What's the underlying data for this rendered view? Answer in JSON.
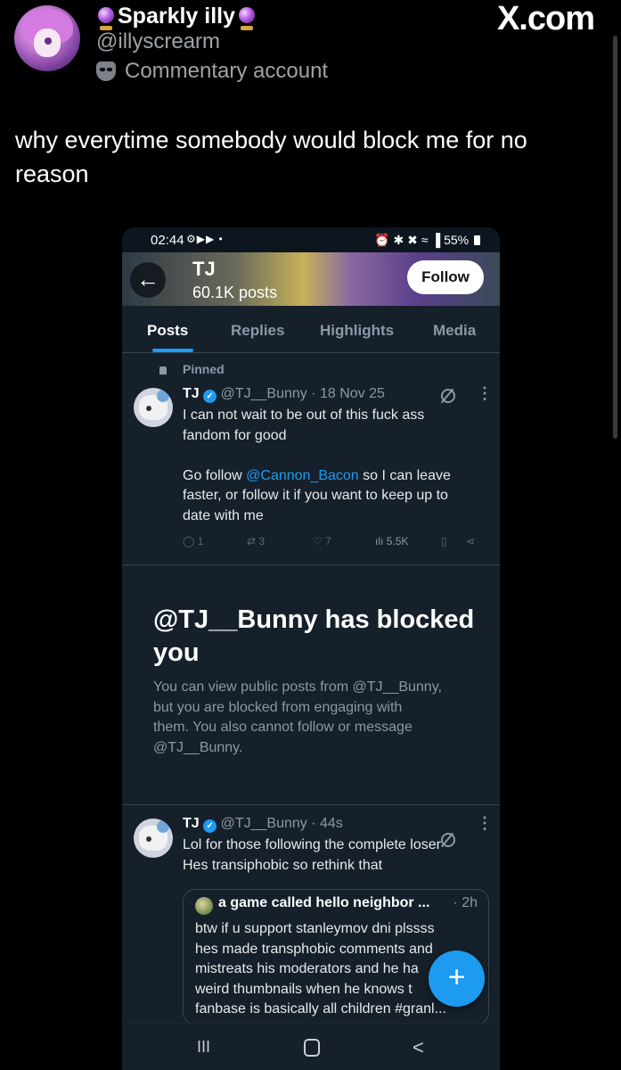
{
  "post": {
    "display_name": "Sparkly illy",
    "handle": "@illyscrearm",
    "account_label": "Commentary account",
    "brand": "X.com",
    "text": "why everytime somebody would block me for no reason"
  },
  "screenshot": {
    "statusbar": {
      "time": "02:44",
      "left_icons": "⚙▶▶ •",
      "right_icons": "⏰ ✱ ✖ ≈ ▐ 55%"
    },
    "profile": {
      "name": "TJ",
      "posts": "60.1K posts",
      "follow_label": "Follow",
      "back_icon": "←"
    },
    "tabs": [
      "Posts",
      "Replies",
      "Highlights",
      "Media"
    ],
    "pinned_label": "Pinned",
    "tweet1": {
      "name": "TJ",
      "handle_time": "@TJ__Bunny · 18 Nov 25",
      "line1": "I can not wait to be out of this fuck ass",
      "line2": "fandom for good",
      "line3_pre": "Go follow ",
      "mention": "@Cannon_Bacon",
      "line3_post": " so I can leave",
      "line4": "faster, or follow it if you want to keep up to",
      "line5": "date with me",
      "replies": "1",
      "reposts": "3",
      "likes": "7",
      "views": "5.5K"
    },
    "blocked": {
      "title_line1": "@TJ__Bunny has blocked",
      "title_line2": "you",
      "desc_line1": "You can view public posts from @TJ__Bunny,",
      "desc_line2": "but you are blocked from engaging with",
      "desc_line3": "them. You also cannot follow or message",
      "desc_line4": "@TJ__Bunny."
    },
    "tweet2": {
      "name": "TJ",
      "handle_time": "@TJ__Bunny · 44s",
      "line1": "Lol for those following the complete loser",
      "line2": "Hes transiphobic so rethink that"
    },
    "quote": {
      "name": "a game called hello neighbor ...",
      "time": "· 2h",
      "line1": "btw if u support stanleymov dni plssss",
      "line2": "hes made transphobic comments and",
      "line3": "mistreats his moderators and he ha",
      "line4": "weird thumbnails when he knows t",
      "line5": "fanbase is basically all children #granl..."
    },
    "fab_icon": "+",
    "nav": {
      "recents": "III",
      "back": "<"
    }
  }
}
